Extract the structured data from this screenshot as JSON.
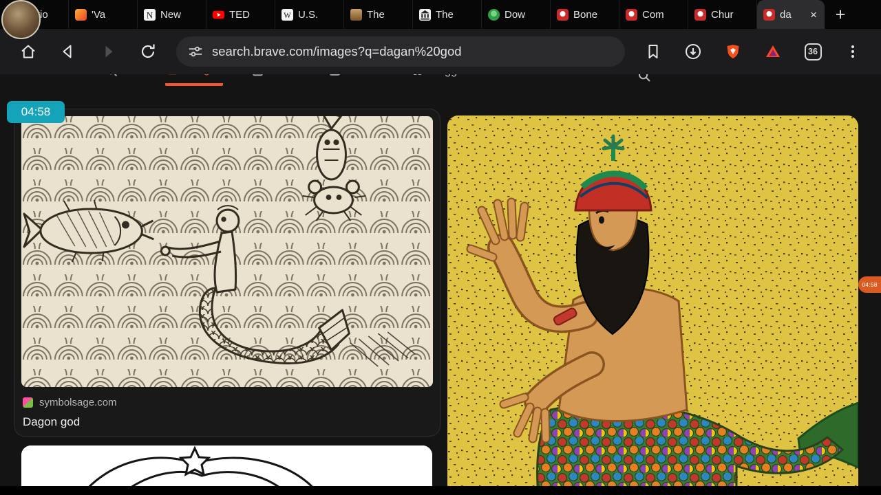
{
  "recording_overlay": {
    "timer": "04:58",
    "side_timer": "04:58"
  },
  "tabstrip": {
    "tabs": [
      {
        "label": "Motio"
      },
      {
        "label": "'Va"
      },
      {
        "label": "New"
      },
      {
        "label": "TED"
      },
      {
        "label": "U.S."
      },
      {
        "label": "The"
      },
      {
        "label": "The"
      },
      {
        "label": "Dow"
      },
      {
        "label": "Bone"
      },
      {
        "label": "Com"
      },
      {
        "label": "Chur"
      },
      {
        "label": "da"
      }
    ],
    "close_glyph": "×",
    "new_tab_glyph": "+"
  },
  "toolbar": {
    "url": "search.brave.com/images?q=dagan%20god",
    "tab_count": "36"
  },
  "page": {
    "nav": [
      {
        "label": "All"
      },
      {
        "label": "Images"
      },
      {
        "label": "News"
      },
      {
        "label": "Videos"
      },
      {
        "label": "Goggles"
      }
    ],
    "result": {
      "source": "symbolsage.com",
      "title": "Dagon god"
    }
  },
  "icons": {
    "home": "house-outline",
    "back": "triangle-left-outline",
    "forward": "triangle-right-disabled",
    "reload": "circular-arrow",
    "tune": "slider-lines",
    "bookmark": "bookmark-outline",
    "download": "circle-down-arrow",
    "brave_shield": "orange-shield",
    "brave_rewards": "bat-triangle",
    "menu": "three-vertical-dots",
    "search": "magnifier"
  },
  "colors": {
    "brave_orange": "#fb542b",
    "timer_teal": "#14a3b8",
    "side_badge_orange": "#eb6224"
  }
}
